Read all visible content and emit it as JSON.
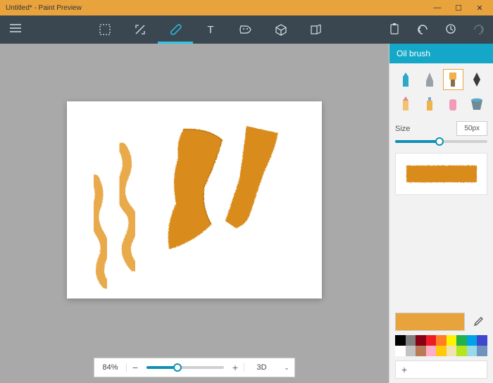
{
  "window": {
    "title": "Untitled* - Paint Preview",
    "minimize": "—",
    "maximize": "☐",
    "close": "✕"
  },
  "toolbar": {
    "menu_icon": "≡",
    "tools": {
      "select": "Select",
      "crop": "Crop",
      "brush": "Brush",
      "text": "Text",
      "sticker": "Sticker",
      "shapes3d": "3D Shapes",
      "models3d": "3D Models"
    },
    "right": {
      "paste": "Paste",
      "undo": "Undo",
      "history": "History",
      "redo": "Redo"
    }
  },
  "zoom": {
    "value": "84%",
    "view3d": "3D"
  },
  "sidebar": {
    "header": "Oil brush",
    "size_label": "Size",
    "size_value": "50px",
    "add_label": "+"
  },
  "colors": {
    "current": "#e8a33d",
    "palette": [
      "#000000",
      "#7f7f7f",
      "#870014",
      "#ed1c24",
      "#ff7f27",
      "#fff200",
      "#22b14c",
      "#00a2e8",
      "#3f48cc",
      "#ffffff",
      "#c3c3c3",
      "#b97a57",
      "#ffaec9",
      "#ffc90e",
      "#efe4b0",
      "#b5e61d",
      "#99d9ea",
      "#7092be"
    ]
  }
}
